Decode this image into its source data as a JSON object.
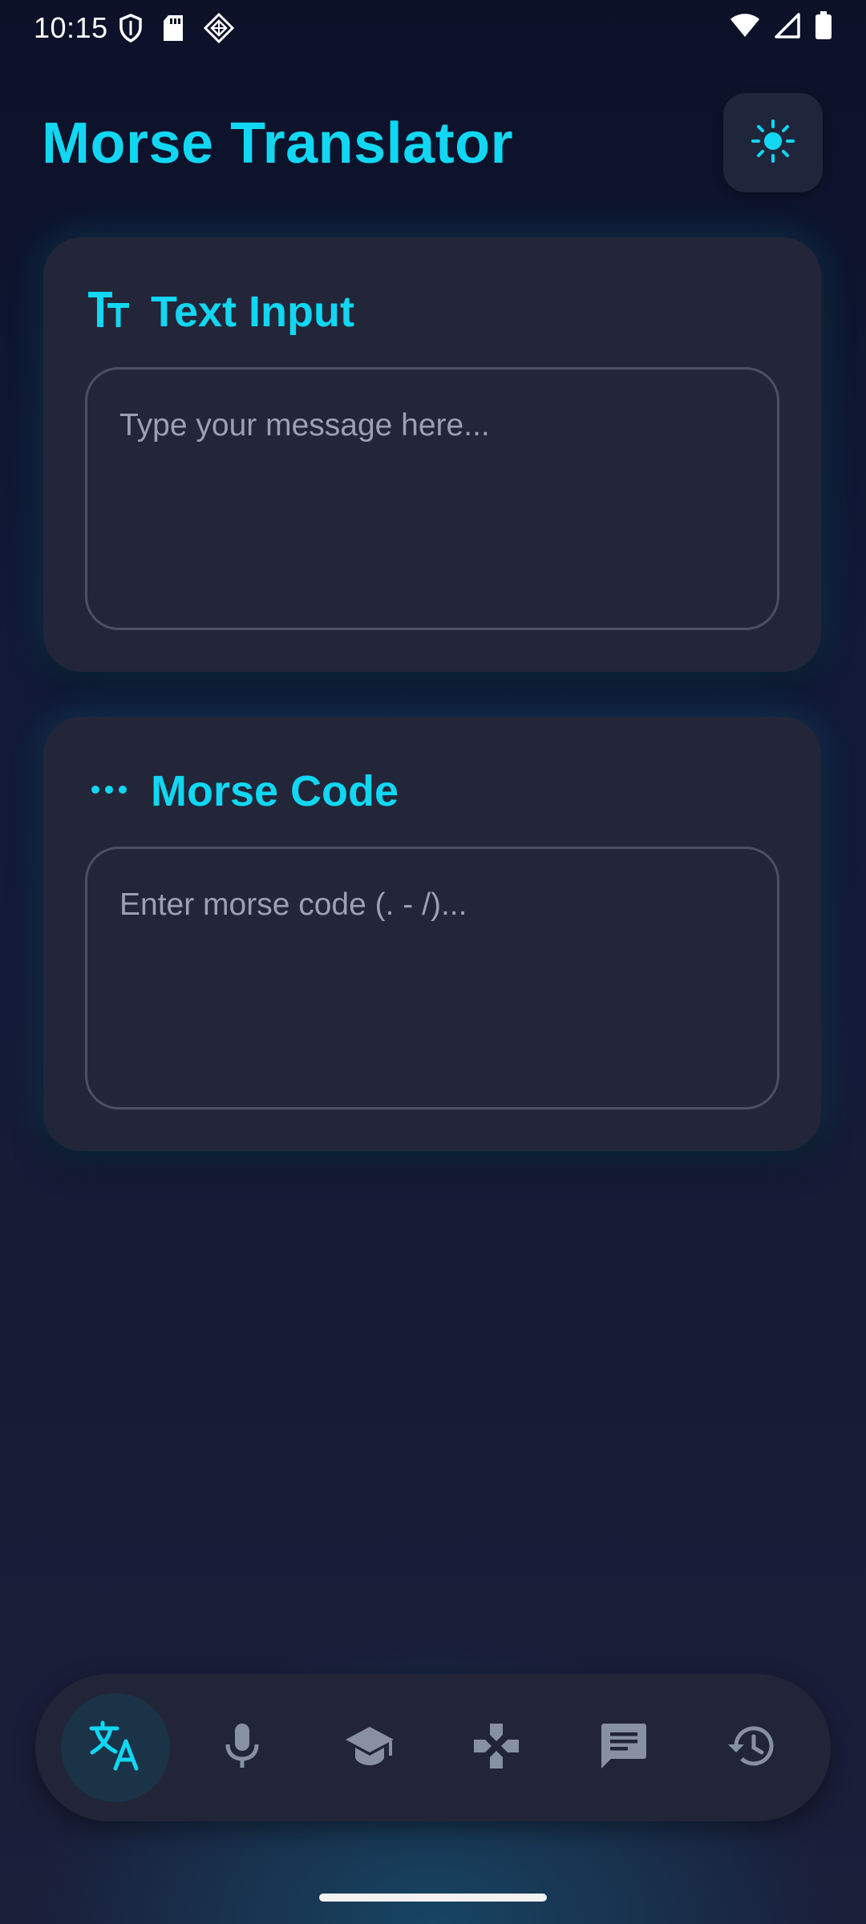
{
  "status_bar": {
    "time": "10:15",
    "left_icons": [
      "shield-icon",
      "sd-card-icon",
      "vpn-diamond-icon"
    ],
    "right_icons": [
      "wifi-icon",
      "signal-icon",
      "battery-icon"
    ]
  },
  "header": {
    "title": "Morse Translator",
    "theme_toggle_icon": "sun-icon"
  },
  "text_card": {
    "icon": "text-format-icon",
    "title": "Text Input",
    "input": {
      "value": "",
      "placeholder": "Type your message here..."
    }
  },
  "morse_card": {
    "icon": "dots-icon",
    "title": "Morse Code",
    "input": {
      "value": "",
      "placeholder": "Enter morse code (. - /)..."
    }
  },
  "bottom_nav": {
    "items": [
      {
        "icon": "translate-icon",
        "active": true
      },
      {
        "icon": "microphone-icon",
        "active": false
      },
      {
        "icon": "school-icon",
        "active": false
      },
      {
        "icon": "gamepad-icon",
        "active": false
      },
      {
        "icon": "chat-icon",
        "active": false
      },
      {
        "icon": "history-icon",
        "active": false
      }
    ]
  },
  "colors": {
    "accent": "#11d7f2",
    "card_background": "#222638",
    "inactive_icon": "#8a90a4",
    "page_background": "#121a38"
  }
}
